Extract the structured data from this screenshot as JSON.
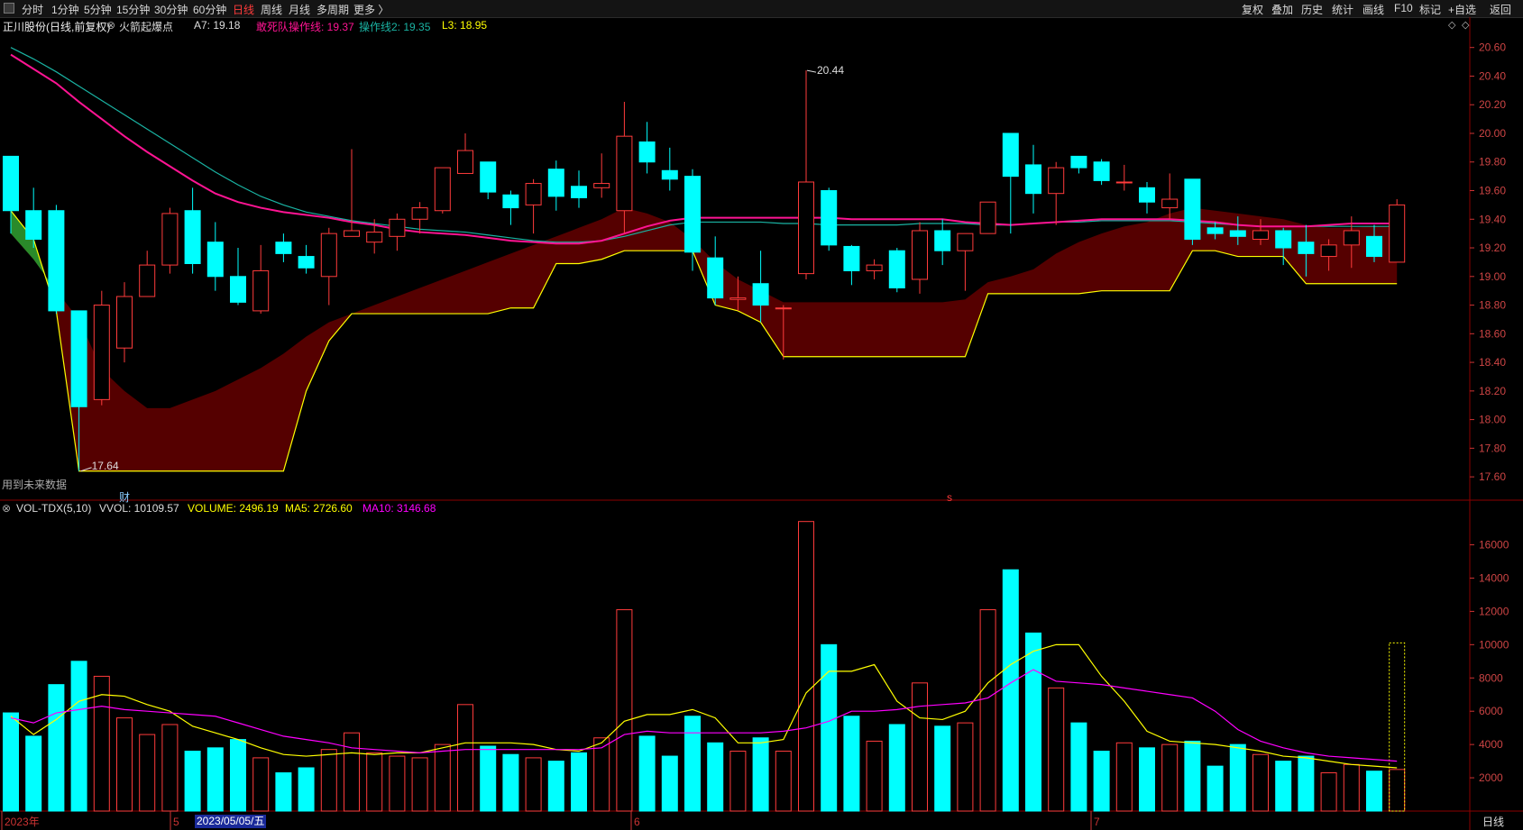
{
  "toolbar": {
    "left_items": [
      "分时",
      "1分钟",
      "5分钟",
      "15分钟",
      "30分钟",
      "60分钟",
      "日线",
      "周线",
      "月线",
      "多周期",
      "更多 〉"
    ],
    "active": "日线",
    "right_items": [
      "复权",
      "叠加",
      "历史",
      "统计",
      "画线",
      "F10",
      "标记",
      "+自选",
      "返回"
    ]
  },
  "info": {
    "stock": "正川股份(日线,前复权)",
    "indicator": "火箭起爆点",
    "a7": "A7: 19.18",
    "line1": "敢死队操作线: 19.37",
    "line2": "操作线2: 19.35",
    "l3": "L3: 18.95",
    "note": "用到未来数据",
    "cai": "财",
    "s_mark": "s",
    "high_label": "20.44",
    "low_label": "17.64"
  },
  "vol_info": {
    "name": "VOL-TDX(5,10)",
    "vvol": "VVOL: 10109.57",
    "volume": "VOLUME: 2496.19",
    "ma5": "MA5: 2726.60",
    "ma10": "MA10: 3146.68"
  },
  "price_axis": [
    "20.60",
    "20.40",
    "20.20",
    "20.00",
    "19.80",
    "19.60",
    "19.40",
    "19.20",
    "19.00",
    "18.80",
    "18.60",
    "18.40",
    "18.20",
    "18.00",
    "17.80",
    "17.60"
  ],
  "vol_axis": [
    "16000",
    "14000",
    "12000",
    "10000",
    "8000",
    "6000",
    "4000",
    "2000"
  ],
  "date_axis": {
    "year": "2023年",
    "m5": "5",
    "m6": "6",
    "m7": "7",
    "selected": "2023/05/05/五"
  },
  "bottom_tab": "日线",
  "colors": {
    "up": "#ff3b3b",
    "down": "#00ffff",
    "ma1": "#ff1493",
    "ma2": "#1ab3a3",
    "l3": "#ffff00",
    "cloud": "#5a0000",
    "greencloud": "#2a8a2a"
  },
  "chart_data": {
    "type": "candlestick",
    "price_range": [
      17.5,
      20.68
    ],
    "volume_range": [
      0,
      17600
    ],
    "candles": [
      [
        19.84,
        19.46,
        19.84,
        19.3
      ],
      [
        19.46,
        19.26,
        19.62,
        19.2
      ],
      [
        19.46,
        18.76,
        19.5,
        18.74
      ],
      [
        18.76,
        18.09,
        18.76,
        17.64
      ],
      [
        18.14,
        18.8,
        18.9,
        18.1
      ],
      [
        18.5,
        18.86,
        18.96,
        18.4
      ],
      [
        18.86,
        19.08,
        19.18,
        18.86
      ],
      [
        19.08,
        19.44,
        19.48,
        19.02
      ],
      [
        19.46,
        19.09,
        19.62,
        19.02
      ],
      [
        19.24,
        19.0,
        19.38,
        18.9
      ],
      [
        19.0,
        18.82,
        19.2,
        18.8
      ],
      [
        18.76,
        19.04,
        19.22,
        18.74
      ],
      [
        19.24,
        19.16,
        19.3,
        19.1
      ],
      [
        19.14,
        19.06,
        19.22,
        19.02
      ],
      [
        19.0,
        19.3,
        19.34,
        18.8
      ],
      [
        19.28,
        19.32,
        19.89,
        19.28
      ],
      [
        19.24,
        19.31,
        19.4,
        19.16
      ],
      [
        19.28,
        19.4,
        19.44,
        19.18
      ],
      [
        19.4,
        19.48,
        19.52,
        19.3
      ],
      [
        19.46,
        19.76,
        19.76,
        19.44
      ],
      [
        19.72,
        19.88,
        20.0,
        19.74
      ],
      [
        19.8,
        19.59,
        19.8,
        19.54
      ],
      [
        19.57,
        19.48,
        19.6,
        19.36
      ],
      [
        19.5,
        19.65,
        19.68,
        19.3
      ],
      [
        19.75,
        19.56,
        19.81,
        19.46
      ],
      [
        19.63,
        19.55,
        19.74,
        19.48
      ],
      [
        19.62,
        19.65,
        19.86,
        19.55
      ],
      [
        19.46,
        19.98,
        20.22,
        19.3
      ],
      [
        19.94,
        19.8,
        20.08,
        19.72
      ],
      [
        19.74,
        19.68,
        19.9,
        19.6
      ],
      [
        19.7,
        19.17,
        19.75,
        19.04
      ],
      [
        19.13,
        18.85,
        19.28,
        18.8
      ],
      [
        18.84,
        18.85,
        19.0,
        18.76
      ],
      [
        18.95,
        18.8,
        19.18,
        18.68
      ],
      [
        18.78,
        18.78,
        18.8,
        18.42
      ],
      [
        19.02,
        19.66,
        20.44,
        18.98
      ],
      [
        19.6,
        19.22,
        19.62,
        19.18
      ],
      [
        19.21,
        19.04,
        19.22,
        18.94
      ],
      [
        19.04,
        19.08,
        19.12,
        18.98
      ],
      [
        19.18,
        18.92,
        19.2,
        18.89
      ],
      [
        18.98,
        19.32,
        19.38,
        18.88
      ],
      [
        19.32,
        19.18,
        19.4,
        19.08
      ],
      [
        19.18,
        19.3,
        19.3,
        18.9
      ],
      [
        19.3,
        19.52,
        19.52,
        19.3
      ],
      [
        20.0,
        19.7,
        20.0,
        19.3
      ],
      [
        19.78,
        19.58,
        19.92,
        19.44
      ],
      [
        19.58,
        19.76,
        19.8,
        19.36
      ],
      [
        19.84,
        19.76,
        19.84,
        19.72
      ],
      [
        19.8,
        19.67,
        19.82,
        19.64
      ],
      [
        19.66,
        19.66,
        19.78,
        19.6
      ],
      [
        19.62,
        19.52,
        19.66,
        19.44
      ],
      [
        19.48,
        19.54,
        19.72,
        19.4
      ],
      [
        19.68,
        19.26,
        19.68,
        19.22
      ],
      [
        19.34,
        19.3,
        19.38,
        19.26
      ],
      [
        19.32,
        19.28,
        19.42,
        19.22
      ],
      [
        19.26,
        19.32,
        19.4,
        19.22
      ],
      [
        19.32,
        19.2,
        19.34,
        19.08
      ],
      [
        19.24,
        19.16,
        19.36,
        19.0
      ],
      [
        19.14,
        19.22,
        19.26,
        19.04
      ],
      [
        19.22,
        19.32,
        19.42,
        19.06
      ],
      [
        19.28,
        19.14,
        19.36,
        19.1
      ],
      [
        19.1,
        19.5,
        19.54,
        19.1
      ]
    ],
    "volumes": [
      5900,
      4500,
      7600,
      9000,
      8100,
      5600,
      4600,
      5200,
      3600,
      3800,
      4300,
      3200,
      2300,
      2600,
      3700,
      4700,
      3500,
      3300,
      3200,
      4000,
      6400,
      3900,
      3400,
      3200,
      3000,
      3500,
      4400,
      12100,
      4500,
      3300,
      5700,
      4100,
      3600,
      4400,
      3600,
      17400,
      10000,
      5700,
      4200,
      5200,
      7700,
      5100,
      5300,
      12100,
      14500,
      10700,
      7400,
      5300,
      3600,
      4100,
      3800,
      4000,
      4200,
      2700,
      4000,
      3400,
      3000,
      3300,
      2300,
      2800,
      2400,
      2500
    ],
    "ma_line1": [
      20.55,
      20.45,
      20.35,
      20.22,
      20.1,
      19.98,
      19.87,
      19.77,
      19.67,
      19.58,
      19.52,
      19.48,
      19.45,
      19.43,
      19.41,
      19.38,
      19.36,
      19.33,
      19.31,
      19.3,
      19.29,
      19.27,
      19.25,
      19.24,
      19.23,
      19.23,
      19.25,
      19.3,
      19.35,
      19.39,
      19.41,
      19.41,
      19.41,
      19.41,
      19.41,
      19.41,
      19.41,
      19.4,
      19.4,
      19.4,
      19.4,
      19.4,
      19.38,
      19.37,
      19.36,
      19.37,
      19.38,
      19.39,
      19.4,
      19.4,
      19.4,
      19.4,
      19.39,
      19.38,
      19.36,
      19.35,
      19.35,
      19.35,
      19.36,
      19.37,
      19.37,
      19.37
    ],
    "ma_line2": [
      20.6,
      20.52,
      20.43,
      20.33,
      20.23,
      20.13,
      20.03,
      19.93,
      19.83,
      19.73,
      19.64,
      19.56,
      19.5,
      19.45,
      19.42,
      19.39,
      19.37,
      19.35,
      19.33,
      19.32,
      19.31,
      19.29,
      19.27,
      19.25,
      19.24,
      19.24,
      19.25,
      19.28,
      19.32,
      19.36,
      19.38,
      19.38,
      19.38,
      19.38,
      19.37,
      19.37,
      19.36,
      19.36,
      19.36,
      19.36,
      19.37,
      19.37,
      19.37,
      19.36,
      19.36,
      19.37,
      19.38,
      19.38,
      19.39,
      19.39,
      19.39,
      19.39,
      19.38,
      19.37,
      19.36,
      19.35,
      19.35,
      19.35,
      19.35,
      19.35,
      19.35,
      19.35
    ],
    "l3_line": [
      19.46,
      19.26,
      18.76,
      17.64,
      17.64,
      17.64,
      17.64,
      17.64,
      17.64,
      17.64,
      17.64,
      17.64,
      17.64,
      18.2,
      18.55,
      18.74,
      18.74,
      18.74,
      18.74,
      18.74,
      18.74,
      18.74,
      18.78,
      18.78,
      19.09,
      19.09,
      19.12,
      19.18,
      19.18,
      19.18,
      19.18,
      18.8,
      18.76,
      18.68,
      18.44,
      18.44,
      18.44,
      18.44,
      18.44,
      18.44,
      18.44,
      18.44,
      18.44,
      18.88,
      18.88,
      18.88,
      18.88,
      18.88,
      18.9,
      18.9,
      18.9,
      18.9,
      19.18,
      19.18,
      19.14,
      19.14,
      19.14,
      18.95,
      18.95,
      18.95,
      18.95,
      18.95
    ],
    "cloud_top": [
      19.3,
      19.12,
      18.9,
      18.7,
      18.35,
      18.2,
      18.08,
      18.08,
      18.14,
      18.2,
      18.28,
      18.36,
      18.46,
      18.58,
      18.68,
      18.74,
      18.8,
      18.86,
      18.92,
      18.98,
      19.04,
      19.1,
      19.16,
      19.22,
      19.28,
      19.34,
      19.4,
      19.48,
      19.44,
      19.38,
      19.26,
      19.1,
      18.98,
      18.9,
      18.82,
      18.82,
      18.82,
      18.82,
      18.82,
      18.82,
      18.82,
      18.82,
      18.84,
      18.96,
      19.0,
      19.05,
      19.16,
      19.24,
      19.3,
      19.35,
      19.38,
      19.44,
      19.48,
      19.46,
      19.44,
      19.42,
      19.4,
      19.36,
      19.34,
      19.34,
      19.35,
      19.35
    ],
    "vol_ma5": [
      5700,
      4600,
      5500,
      6600,
      7000,
      6900,
      6400,
      6000,
      5100,
      4700,
      4300,
      3800,
      3400,
      3300,
      3400,
      3500,
      3400,
      3500,
      3500,
      3800,
      4100,
      4100,
      4100,
      4000,
      3700,
      3600,
      4100,
      5400,
      5800,
      5800,
      6100,
      5600,
      4100,
      4100,
      4300,
      7100,
      8400,
      8400,
      8800,
      6600,
      5600,
      5500,
      6000,
      7700,
      8800,
      9600,
      10000,
      10000,
      8100,
      6600,
      4800,
      4200,
      4100,
      4000,
      3800,
      3600,
      3300,
      3200,
      3000,
      2800,
      2700,
      2600
    ],
    "vol_ma10": [
      5600,
      5300,
      5900,
      6100,
      6300,
      6100,
      6000,
      5900,
      5800,
      5700,
      5300,
      4900,
      4500,
      4300,
      4100,
      3800,
      3700,
      3600,
      3500,
      3600,
      3700,
      3700,
      3700,
      3700,
      3700,
      3700,
      3800,
      4600,
      4800,
      4700,
      4700,
      4700,
      4700,
      4700,
      4800,
      5000,
      5400,
      6000,
      6000,
      6100,
      6300,
      6400,
      6500,
      6800,
      7700,
      8500,
      7800,
      7700,
      7600,
      7400,
      7200,
      7000,
      6800,
      6000,
      4900,
      4200,
      3800,
      3500,
      3300,
      3200,
      3100,
      3000
    ]
  }
}
